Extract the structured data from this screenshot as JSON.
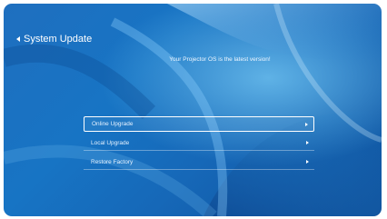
{
  "header": {
    "title": "System Update",
    "back_icon": "chevron-left-icon"
  },
  "status": {
    "message": "Your Projector OS is the latest version!"
  },
  "menu": {
    "selected_index": 0,
    "items": [
      {
        "label": "Online Upgrade",
        "icon": "chevron-right-icon"
      },
      {
        "label": "Local Upgrade",
        "icon": "chevron-right-icon"
      },
      {
        "label": "Restore Factory",
        "icon": "chevron-right-icon"
      }
    ]
  },
  "colors": {
    "background": "#1774c4",
    "accent": "#ffffff"
  }
}
